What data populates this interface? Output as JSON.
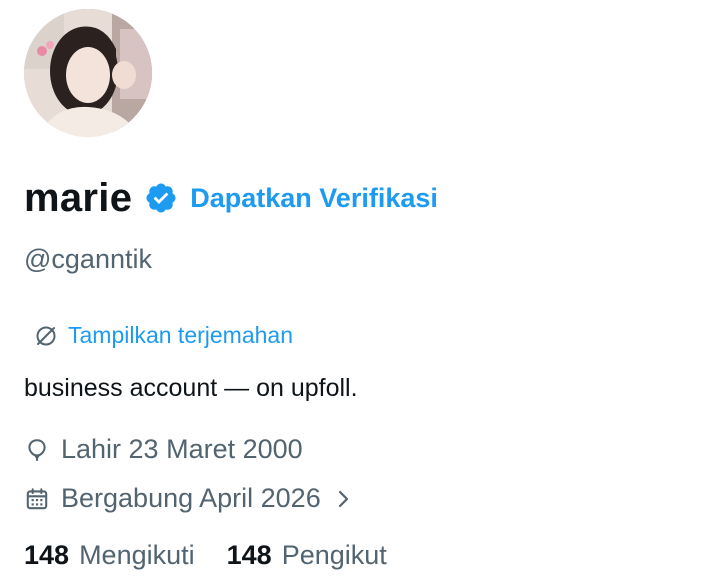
{
  "profile": {
    "avatar_icon": "profile-photo",
    "display_name": "marie",
    "verified_badge_icon": "verified-check-icon",
    "get_verified_label": "Dapatkan Verifikasi",
    "handle": "@cganntik",
    "translate_label": "Tampilkan terjemahan",
    "bio": "business account — on upfoll.",
    "birth_text": "Lahir 23 Maret 2000",
    "joined_text": "Bergabung April 2026",
    "following_count": "148",
    "following_label": "Mengikuti",
    "followers_count": "148",
    "followers_label": "Pengikut"
  },
  "colors": {
    "accent": "#1d9bf0",
    "text_primary": "#0f1419",
    "text_secondary": "#536471",
    "background": "#ffffff"
  }
}
